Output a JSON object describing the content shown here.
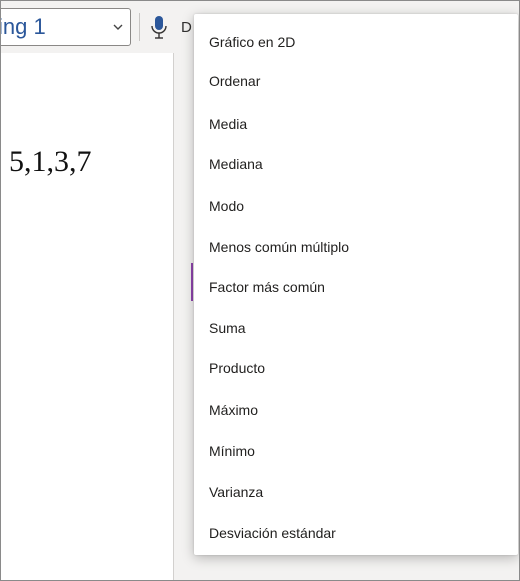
{
  "toolbar": {
    "style_value": "ing 1",
    "dictate_label": "D"
  },
  "document": {
    "visible_text": "5,1,3,7"
  },
  "menu": {
    "items": [
      {
        "label": "Gráfico en 2D"
      },
      {
        "label": "Ordenar"
      },
      {
        "label": "Media"
      },
      {
        "label": "Mediana"
      },
      {
        "label": "Modo"
      },
      {
        "label": "Menos común múltiplo"
      },
      {
        "label": "Factor más común"
      },
      {
        "label": "Suma"
      },
      {
        "label": "Producto"
      },
      {
        "label": "Máximo"
      },
      {
        "label": "Mínimo"
      },
      {
        "label": "Varianza"
      },
      {
        "label": "Desviación estándar"
      }
    ]
  },
  "colors": {
    "style_text": "#2b579a",
    "mic_icon": "#2b579a",
    "accent_mark": "#8e44ad"
  },
  "icons": [
    "chevron-down-icon",
    "microphone-icon"
  ]
}
